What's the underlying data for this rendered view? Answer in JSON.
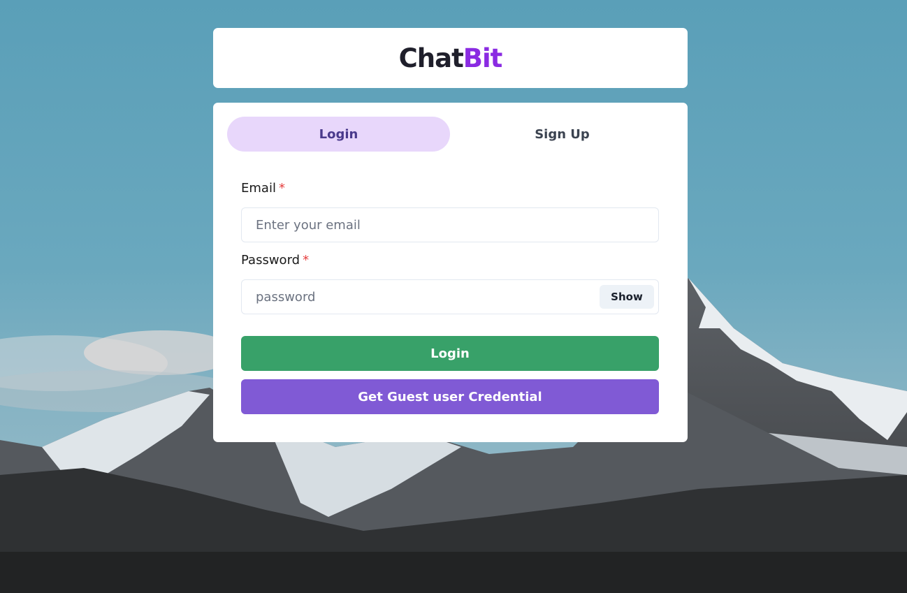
{
  "brand": {
    "part1": "Chat",
    "part2": "Bit"
  },
  "tabs": {
    "login": "Login",
    "signup": "Sign Up"
  },
  "form": {
    "email_label": "Email",
    "email_placeholder": "Enter your email",
    "password_label": "Password",
    "password_placeholder": "password",
    "required_mark": "*",
    "show_label": "Show"
  },
  "buttons": {
    "login": "Login",
    "guest": "Get Guest user Credential"
  },
  "colors": {
    "brand_accent": "#8a2be2",
    "active_tab_bg": "#e8d7fb",
    "login_button": "#38a169",
    "guest_button": "#805ad5",
    "required": "#e53e3e"
  }
}
